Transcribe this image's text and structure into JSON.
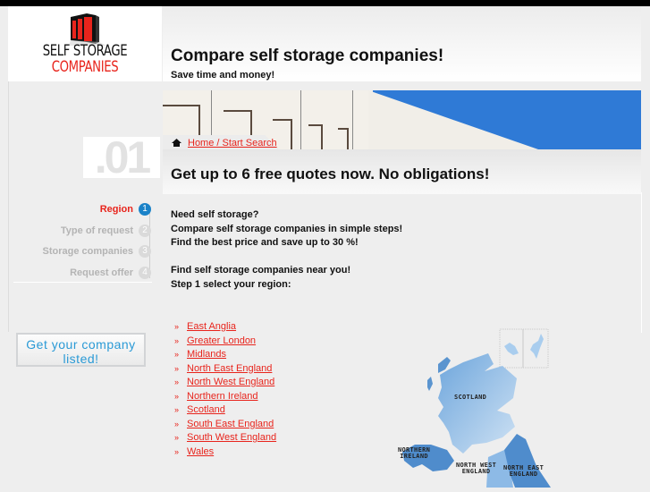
{
  "logo": {
    "line1": "SELF STORAGE",
    "line2": "COMPANIES"
  },
  "header": {
    "title": "Compare self storage companies!",
    "subtitle": "Save time and money!"
  },
  "breadcrumb": {
    "icon": "home-icon",
    "link": "Home / Start Search"
  },
  "steps": {
    "current_number": ".01",
    "items": [
      {
        "label": "Region",
        "number": "1",
        "active": true
      },
      {
        "label": "Type of request",
        "number": "2",
        "active": false
      },
      {
        "label": "Storage companies",
        "number": "3",
        "active": false
      },
      {
        "label": "Request offer",
        "number": "4",
        "active": false
      }
    ]
  },
  "cta": {
    "line1": "Get your company",
    "line2": "listed!"
  },
  "quote_heading": "Get up to 6 free quotes now. No obligations!",
  "intro": {
    "lines": [
      "Need self storage?",
      "Compare self storage companies in simple steps!",
      "Find the best price and save up to 30 %!"
    ],
    "lines2": [
      "Find self storage companies near you!",
      "Step 1 select your region:"
    ]
  },
  "regions": {
    "bullet": "»",
    "items": [
      "East Anglia",
      "Greater London",
      "Midlands",
      "North East England",
      "North West England",
      "Northern Ireland",
      "Scotland",
      "South East England",
      "South West England",
      "Wales"
    ]
  },
  "map": {
    "labels": {
      "scotland": "SCOTLAND",
      "ni1": "NORTHERN",
      "ni2": "IRELAND",
      "nw1": "NORTH WEST",
      "nw2": "ENGLAND",
      "ne1": "NORTH EAST",
      "ne2": "ENGLAND"
    }
  },
  "colors": {
    "accent_red": "#e8241c",
    "accent_blue": "#1a82c8",
    "map_blue": "#5a9ad4"
  }
}
